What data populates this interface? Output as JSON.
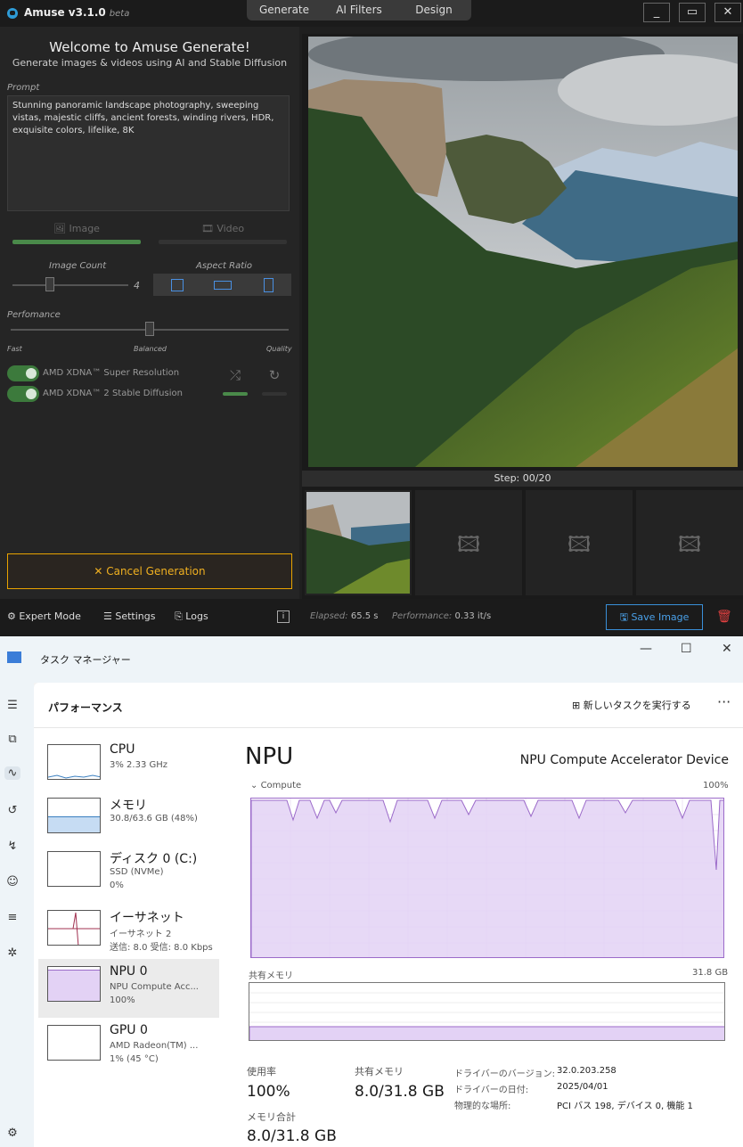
{
  "amuse": {
    "app_title": "Amuse v3.1.0",
    "app_badge": "beta",
    "top_tabs": [
      "Generate",
      "AI Filters",
      "Design"
    ],
    "window_controls": [
      "_",
      "▭",
      "✕"
    ],
    "welcome": "Welcome to Amuse Generate!",
    "subtitle": "Generate images & videos using AI and Stable Diffusion",
    "prompt_label": "Prompt",
    "prompt_text": "Stunning panoramic landscape photography, sweeping vistas, majestic cliffs, ancient forests, winding rivers, HDR, exquisite colors, lifelike, 8K",
    "mode_image": "Image",
    "mode_video": "Video",
    "image_count_label": "Image Count",
    "image_count_value": "4",
    "aspect_ratio_label": "Aspect Ratio",
    "performance_label": "Perfomance",
    "performance_ticks": [
      "Fast",
      "Balanced",
      "Quality"
    ],
    "toggle_super_resolution": "AMD XDNA™ Super Resolution",
    "toggle_stable_diffusion": "AMD XDNA™ 2 Stable Diffusion",
    "cancel_button": "Cancel Generation",
    "step_text": "Step: 00/20",
    "bottom": {
      "expert_mode": "Expert Mode",
      "settings": "Settings",
      "logs": "Logs",
      "elapsed_label": "Elapsed:",
      "elapsed_value": "65.5 s",
      "performance_label": "Performance:",
      "performance_value": "0.33 it/s",
      "save_image": "Save Image"
    },
    "colors": {
      "accent_green": "#4a8a4a",
      "cancel_border": "#e8a300",
      "save_blue": "#3a8fd8"
    }
  },
  "taskmanager": {
    "title": "タスク マネージャー",
    "section": "パフォーマンス",
    "run_new_task": "新しいタスクを実行する",
    "more": "···",
    "cards": [
      {
        "name": "CPU",
        "sub1": "3%  2.33 GHz",
        "sub2": ""
      },
      {
        "name": "メモリ",
        "sub1": "30.8/63.6 GB (48%)",
        "sub2": ""
      },
      {
        "name": "ディスク 0 (C:)",
        "sub1": "SSD (NVMe)",
        "sub2": "0%"
      },
      {
        "name": "イーサネット",
        "sub1": "イーサネット 2",
        "sub2": "送信: 8.0  受信: 8.0 Kbps"
      },
      {
        "name": "NPU 0",
        "sub1": "NPU Compute Acc...",
        "sub2": "100%"
      },
      {
        "name": "GPU 0",
        "sub1": "AMD Radeon(TM) ...",
        "sub2": "1%  (45 °C)"
      }
    ],
    "npu_title": "NPU",
    "device_name": "NPU Compute Accelerator Device",
    "compute_label": "Compute",
    "compute_max": "100%",
    "compute_utilization_percent": 100,
    "shared_memory_label": "共有メモリ",
    "shared_memory_max": "31.8 GB",
    "stats": {
      "usage_label": "使用率",
      "usage_value": "100%",
      "shared_label": "共有メモリ",
      "shared_value": "8.0/31.8 GB",
      "total_label": "メモリ合計",
      "total_value": "8.0/31.8 GB"
    },
    "details": [
      {
        "key": "ドライバーのバージョン:",
        "value": "32.0.203.258"
      },
      {
        "key": "ドライバーの日付:",
        "value": "2025/04/01"
      },
      {
        "key": "物理的な場所:",
        "value": "PCI バス 198, デバイス 0, 機能 1"
      }
    ],
    "colors": {
      "npu_purple": "#9b6ac9",
      "npu_fill": "#e3d2f5"
    }
  }
}
